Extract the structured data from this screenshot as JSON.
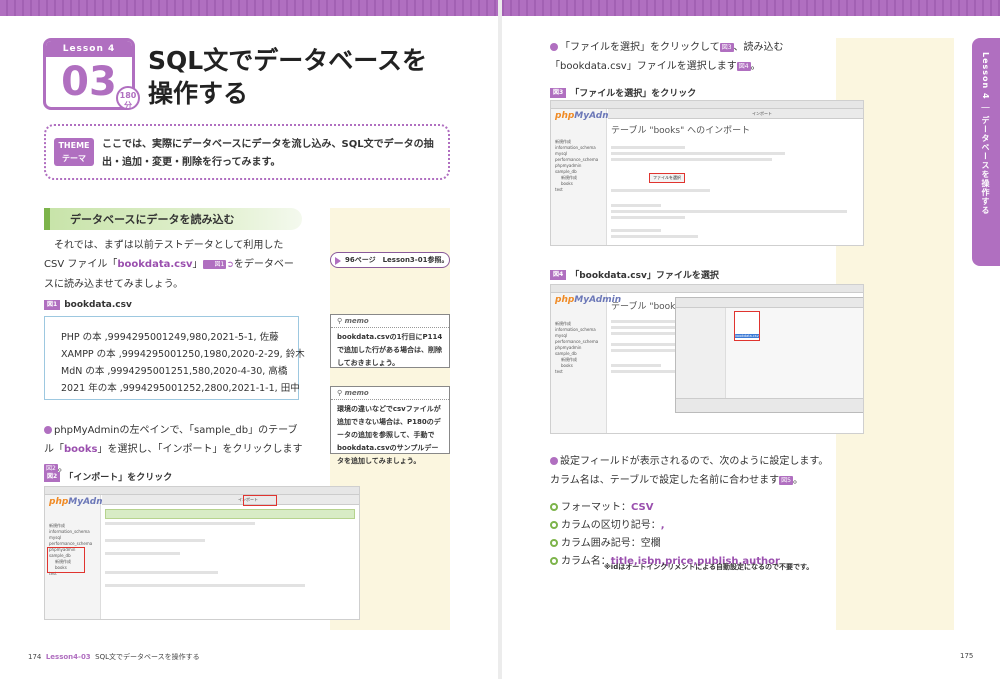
{
  "lesson": {
    "label": "Lesson 4",
    "number": "03",
    "minutes": "180",
    "minutes_unit": "分",
    "title_line1": "SQL文でデータベースを",
    "title_line2": "操作する"
  },
  "theme": {
    "tag_line1": "THEME",
    "tag_line2": "テーマ",
    "text": "ここでは、実際にデータベースにデータを流し込み、SQL文でデータの抽出・追加・変更・削除を行ってみます。"
  },
  "section": {
    "heading": "データベースにデータを読み込む"
  },
  "intro": {
    "p1": "それでは、まずは以前テストデータとして利用したCSV ファイル「",
    "file": "bookdata.csv",
    "p2": "」",
    "fig": "図1",
    "p3": "をデータベースに読み込ませてみましょう。"
  },
  "figure1": {
    "tag": "図1",
    "label": "bookdata.csv",
    "rows": [
      "PHP の本 ,9994295001249,980,2021-5-1, 佐藤",
      "XAMPP の本 ,9994295001250,1980,2020-2-29, 鈴木",
      "MdN の本 ,9994295001251,580,2020-4-30, 高橋",
      "2021 年の本 ,9994295001252,2800,2021-1-1, 田中"
    ]
  },
  "step1": {
    "text_a": "phpMyAdminの左ペインで、「sample_db」のテーブル「",
    "table": "books",
    "text_b": "」を選択し、「インポート」をクリックします",
    "fig": "図2",
    "text_c": "。"
  },
  "figure2": {
    "tag": "図2",
    "label": "「インポート」をクリック"
  },
  "sidenotes": {
    "ref": "96ページ　Lesson3-01参照。",
    "memo1_head": "memo",
    "memo1_body": "bookdata.csvの1行目にP114で追加した行がある場合は、削除しておきましょう。",
    "memo2_head": "memo",
    "memo2_body": "環境の違いなどでcsvファイルが追加できない場合は、P180のデータの追加を参照して、手動でbookdata.csvのサンプルデータを追加してみましょう。"
  },
  "step2": {
    "text": "「ファイルを選択」をクリックして",
    "fig": "図3",
    "text_b": "、読み込む「bookdata.csv」ファイルを選択します",
    "fig2": "図4",
    "text_c": "。"
  },
  "figure3": {
    "tag": "図3",
    "label": "「ファイルを選択」をクリック"
  },
  "figure4": {
    "tag": "図4",
    "label": "「bookdata.csv」ファイルを選択"
  },
  "step3": {
    "text": "設定フィールドが表示されるので、次のように設定します。カラム名は、テーブルで設定した名前に合わせます",
    "fig": "図5",
    "text_b": "。"
  },
  "settings": [
    {
      "label": "フォーマット：",
      "value": "CSV"
    },
    {
      "label": "カラムの区切り記号：",
      "value": ","
    },
    {
      "label": "カラム囲み記号：",
      "value": "空欄"
    },
    {
      "label": "カラム名：",
      "value": "title,isbn,price,publish,author"
    }
  ],
  "settings_note": "※idはオートインクリメントによる自動設定になるので不要です。",
  "pma": {
    "logo_a": "php",
    "logo_b": "MyAdmin",
    "title": "テーブル \"books\" へのインポート",
    "import_tab": "インポート",
    "file_button": "ファイルを選択",
    "tree": [
      "新規作成",
      "information_schema",
      "mysql",
      "performance_schema",
      "phpmyadmin",
      "sample_db",
      "新規作成",
      "books",
      "test"
    ],
    "file_selected": "bookdata.csv"
  },
  "side_tab": "Lesson 4 ｜ データベースを操作する",
  "footer": {
    "left_page": "174",
    "left_lesson": "Lesson4-03",
    "left_title": "SQL文でデータベースを操作する",
    "right_page": "175"
  }
}
